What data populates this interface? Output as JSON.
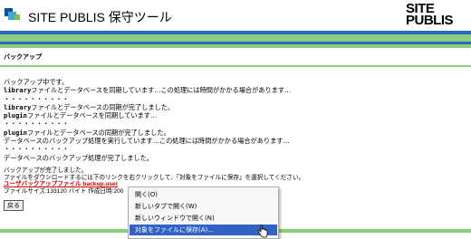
{
  "header": {
    "title": "SITE PUBLIS 保守ツール",
    "logo_line1": "SITE",
    "logo_line2": "PUBLIS"
  },
  "section": {
    "title": "バックアップ"
  },
  "log": {
    "line1": "バックアップ中です。",
    "line2_prefix": "library",
    "line2_text": "ファイルとデータベースを同期しています…この処理には時間がかかる場合があります…",
    "dots1": "・・・・・・・・・・",
    "line3_prefix": "library",
    "line3_text": "ファイルとデータベースの同期が完了しました。",
    "line4_prefix": "plugin",
    "line4_text": "ファイルとデータベースを同期しています…",
    "dots2": "・・・・・・・・・・",
    "line5_prefix": "plugin",
    "line5_text": "ファイルとデータベースの同期が完了しました。",
    "line6": "データベースのバックアップ処理を実行しています…この処理には時間がかかる場合があります…",
    "dots3": "・・・・・・・・・・",
    "line7": "データベースのバックアップ処理が完了しました。"
  },
  "result": {
    "done": "バックアップが完了しました。",
    "instruction": "ファイルをダウンロードするには下のリンクを右クリックして、「対象をファイルに保存」を選択してください。",
    "link": "ユーザバックアップファイル backup.user",
    "filesize": "ファイルサイズ:133120 バイト 作成日時:200"
  },
  "back_button": "戻る",
  "context_menu": {
    "items": [
      "開く(O)",
      "新しいタブで開く(W)",
      "新しいウィンドウで開く(N)",
      "対象をファイルに保存(A)..."
    ]
  },
  "colors": {
    "stripe_blue": "#2d66c8",
    "stripe_green": "#8ad07a",
    "link_red": "#d00000",
    "menu_highlight": "#3262c4"
  }
}
